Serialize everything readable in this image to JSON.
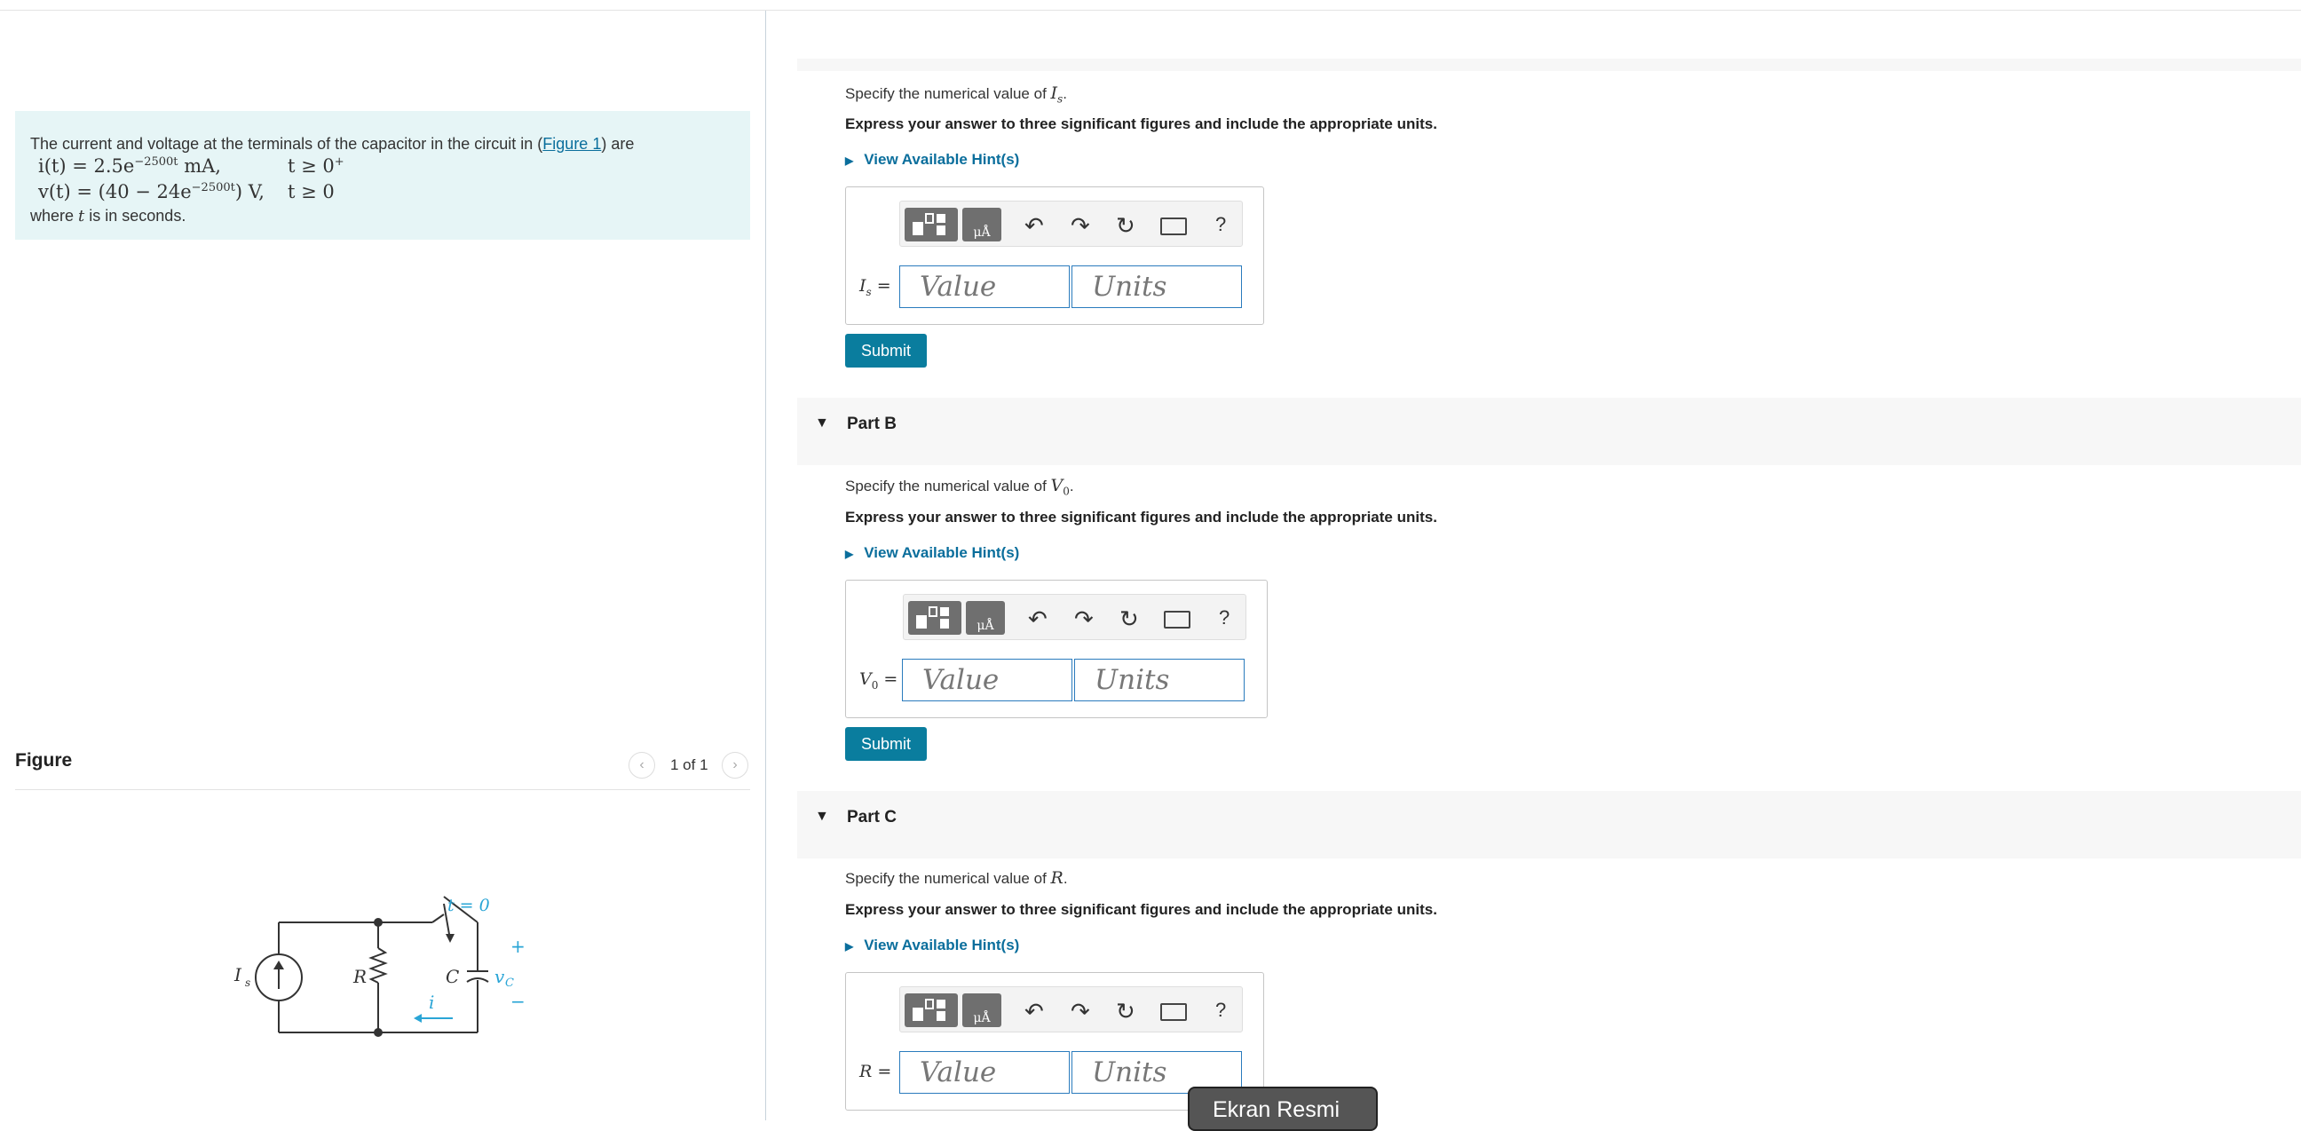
{
  "problem": {
    "intro_before": "The current and voltage at the terminals of the capacitor in the circuit in (",
    "figure_link": "Figure 1",
    "intro_after": ") are",
    "eq_i_main": "i(t) = 2.5e",
    "eq_i_exp": "−2500t",
    "eq_i_unit": " mA,",
    "eq_i_cond": "t ≥ 0",
    "eq_i_cond_sup": "+",
    "eq_v_main": "v(t) = (40 − 24e",
    "eq_v_exp": "−2500t",
    "eq_v_unit": ") V,",
    "eq_v_cond": "t ≥ 0",
    "where_before": "where ",
    "where_var": "t",
    "where_after": " is in seconds."
  },
  "figure": {
    "title": "Figure",
    "counter": "1 of 1",
    "labels": {
      "source": "I",
      "source_sub": "s",
      "resistor": "R",
      "capacitor": "C",
      "switch": "t = 0",
      "current": "i",
      "voltage": "v",
      "voltage_sub": "C",
      "plus": "+",
      "minus": "−"
    }
  },
  "parts": [
    {
      "title": "",
      "spec_text": "Specify the numerical value of ",
      "spec_var": "I",
      "spec_sub": "s",
      "express": "Express your answer to three significant figures and include the appropriate units.",
      "hint": "View Available Hint(s)",
      "label_var": "I",
      "label_sub": "s",
      "value_placeholder": "Value",
      "units_placeholder": "Units",
      "submit": "Submit"
    },
    {
      "title": "Part B",
      "spec_text": "Specify the numerical value of ",
      "spec_var": "V",
      "spec_sub": "0",
      "express": "Express your answer to three significant figures and include the appropriate units.",
      "hint": "View Available Hint(s)",
      "label_var": "V",
      "label_sub": "0",
      "value_placeholder": "Value",
      "units_placeholder": "Units",
      "submit": "Submit"
    },
    {
      "title": "Part C",
      "spec_text": "Specify the numerical value of ",
      "spec_var": "R",
      "spec_sub": "",
      "express": "Express your answer to three significant figures and include the appropriate units.",
      "hint": "View Available Hint(s)",
      "label_var": "R",
      "label_sub": "",
      "value_placeholder": "Value",
      "units_placeholder": "Units"
    }
  ],
  "toolbar": {
    "unit_symbol": "μÅ",
    "help": "?"
  },
  "tooltip": "Ekran Resmi",
  "colors": {
    "accent": "#0a7d9e",
    "link": "#0a6e9c",
    "problem_bg": "#e6f5f6",
    "circuit_accent": "#2aa5d6"
  }
}
